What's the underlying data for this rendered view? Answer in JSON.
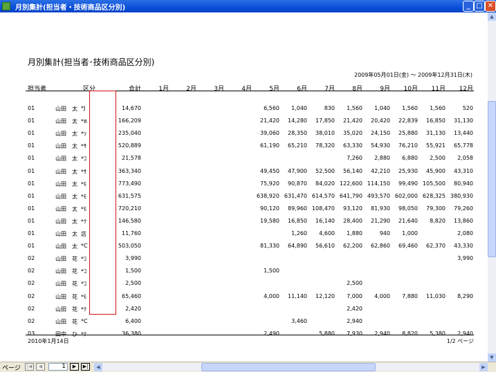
{
  "window": {
    "title": "月別集計(担当者・技術商品区分別)"
  },
  "report": {
    "title": "月別集計(担当者･技術商品区分別)",
    "period": "2009年05月01日(金) ～  2009年12月31日(木)",
    "headers": [
      "担当者",
      "区分",
      "合計",
      "1月",
      "2月",
      "3月",
      "4月",
      "5月",
      "6月",
      "7月",
      "8月",
      "9月",
      "10月",
      "11月",
      "12月"
    ],
    "rows": [
      {
        "code": "01",
        "name": "山田　太",
        "cat": "*J",
        "vals": [
          "14,670",
          "",
          "",
          "",
          "",
          "6,560",
          "1,040",
          "830",
          "1,560",
          "1,040",
          "1,560",
          "1,560",
          "520"
        ]
      },
      {
        "code": "01",
        "name": "山田　太",
        "cat": "*គ",
        "vals": [
          "166,209",
          "",
          "",
          "",
          "",
          "21,420",
          "14,280",
          "17,850",
          "21,420",
          "20,420",
          "22,839",
          "16,850",
          "31,130"
        ]
      },
      {
        "code": "01",
        "name": "山田　太",
        "cat": "*ｿ",
        "vals": [
          "235,040",
          "",
          "",
          "",
          "",
          "39,060",
          "28,350",
          "38,010",
          "35,020",
          "24,150",
          "25,880",
          "31,130",
          "13,440"
        ]
      },
      {
        "code": "01",
        "name": "山田　太",
        "cat": "*ｻ",
        "vals": [
          "520,889",
          "",
          "",
          "",
          "",
          "61,190",
          "65,210",
          "78,320",
          "63,330",
          "54,930",
          "76,210",
          "55,921",
          "65,778"
        ]
      },
      {
        "code": "01",
        "name": "山田　太",
        "cat": "*ｺ",
        "vals": [
          "21,578",
          "",
          "",
          "",
          "",
          "",
          "",
          "",
          "7,260",
          "2,880",
          "6,880",
          "2,500",
          "2,058"
        ]
      },
      {
        "code": "01",
        "name": "山田　太",
        "cat": "*ｻ",
        "vals": [
          "363,340",
          "",
          "",
          "",
          "",
          "49,450",
          "47,900",
          "52,500",
          "56,140",
          "42,210",
          "25,930",
          "45,900",
          "43,310"
        ]
      },
      {
        "code": "01",
        "name": "山田　太",
        "cat": "*ﾓ",
        "vals": [
          "773,490",
          "",
          "",
          "",
          "",
          "75,920",
          "90,870",
          "84,020",
          "122,600",
          "114,150",
          "99,490",
          "105,500",
          "80,940"
        ]
      },
      {
        "code": "01",
        "name": "山田　太",
        "cat": "*ﾓ",
        "vals": [
          "631,575",
          "",
          "",
          "",
          "",
          "638,920",
          "631,470",
          "614,570",
          "641,790",
          "493,570",
          "602,000",
          "628,325",
          "380,930"
        ]
      },
      {
        "code": "01",
        "name": "山田　太",
        "cat": "*ﾓ",
        "vals": [
          "720,210",
          "",
          "",
          "",
          "",
          "90,120",
          "89,960",
          "108,470",
          "93,120",
          "81,930",
          "98,050",
          "79,300",
          "79,260"
        ]
      },
      {
        "code": "01",
        "name": "山田　太",
        "cat": "*ｸ",
        "vals": [
          "146,580",
          "",
          "",
          "",
          "",
          "19,580",
          "16,850",
          "16,140",
          "28,400",
          "21,290",
          "21,640",
          "8,820",
          "13,860"
        ]
      },
      {
        "code": "01",
        "name": "山田　太",
        "cat": "店",
        "vals": [
          "11,760",
          "",
          "",
          "",
          "",
          "",
          "1,260",
          "4,600",
          "1,880",
          "940",
          "1,000",
          "",
          "2,080"
        ]
      },
      {
        "code": "01",
        "name": "山田　太",
        "cat": "*C",
        "vals": [
          "503,050",
          "",
          "",
          "",
          "",
          "81,330",
          "64,890",
          "56,610",
          "62,200",
          "62,860",
          "69,460",
          "62,370",
          "43,330"
        ]
      },
      {
        "code": "02",
        "name": "山田　花",
        "cat": "*ｺ",
        "vals": [
          "3,990",
          "",
          "",
          "",
          "",
          "",
          "",
          "",
          "",
          "",
          "",
          "",
          "3,990"
        ]
      },
      {
        "code": "02",
        "name": "山田　花",
        "cat": "*ｺ",
        "vals": [
          "1,500",
          "",
          "",
          "",
          "",
          "1,500",
          "",
          "",
          "",
          "",
          "",
          "",
          ""
        ]
      },
      {
        "code": "02",
        "name": "山田　花",
        "cat": "*ｺ",
        "vals": [
          "2,500",
          "",
          "",
          "",
          "",
          "",
          "",
          "",
          "2,500",
          "",
          "",
          "",
          ""
        ]
      },
      {
        "code": "02",
        "name": "山田　花",
        "cat": "*ﾓ",
        "vals": [
          "65,460",
          "",
          "",
          "",
          "",
          "4,000",
          "11,140",
          "12,120",
          "7,000",
          "4,000",
          "7,880",
          "11,030",
          "8,290"
        ]
      },
      {
        "code": "02",
        "name": "山田　花",
        "cat": "*ｸ",
        "vals": [
          "2,420",
          "",
          "",
          "",
          "",
          "",
          "",
          "",
          "2,420",
          "",
          "",
          "",
          ""
        ]
      },
      {
        "code": "02",
        "name": "山田　花",
        "cat": "*C",
        "vals": [
          "6,400",
          "",
          "",
          "",
          "",
          "",
          "3,460",
          "",
          "2,940",
          "",
          "",
          "",
          ""
        ]
      },
      {
        "code": "03",
        "name": "田中　ひ",
        "cat": "*ｸ",
        "vals": [
          "36,380",
          "",
          "",
          "",
          "",
          "2,490",
          "",
          "5,880",
          "7,930",
          "2,940",
          "8,820",
          "5,380",
          "2,940"
        ]
      }
    ],
    "footer_date": "2010年1月14日",
    "footer_page": "1/2 ページ"
  },
  "statusbar": {
    "page_label": "ページ",
    "page_value": "1"
  },
  "icons": {
    "first": "first-page-icon",
    "prev": "prev-page-icon",
    "next": "next-page-icon",
    "last": "last-page-icon"
  }
}
